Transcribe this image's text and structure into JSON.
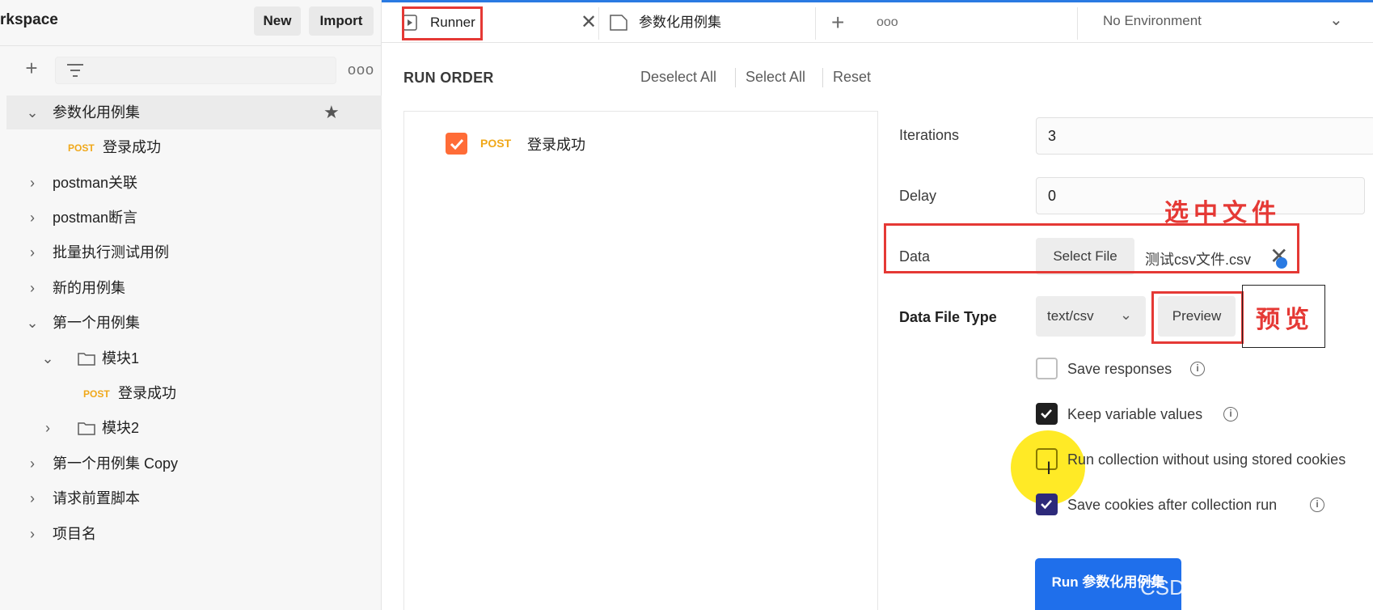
{
  "sidebar": {
    "workspace_title": "rkspace",
    "new_label": "New",
    "import_label": "Import",
    "more_label": "ooo",
    "tree": [
      {
        "label": "参数化用例集",
        "expanded": true,
        "starred": true
      },
      {
        "method": "POST",
        "label": "登录成功"
      },
      {
        "label": "postman关联"
      },
      {
        "label": "postman断言"
      },
      {
        "label": "批量执行测试用例"
      },
      {
        "label": "新的用例集"
      },
      {
        "label": "第一个用例集",
        "expanded": true
      },
      {
        "label": "模块1",
        "folder": true,
        "expanded": true
      },
      {
        "method": "POST",
        "label": "登录成功"
      },
      {
        "label": "模块2",
        "folder": true
      },
      {
        "label": "第一个用例集 Copy"
      },
      {
        "label": "请求前置脚本"
      },
      {
        "label": "项目名"
      }
    ]
  },
  "tabs": {
    "runner_label": "Runner",
    "collection_tab_label": "参数化用例集",
    "more_label": "ooo",
    "environment": "No Environment"
  },
  "run_order": {
    "title": "RUN ORDER",
    "deselect_all": "Deselect All",
    "select_all": "Select All",
    "reset": "Reset",
    "items": [
      {
        "method": "POST",
        "name": "登录成功",
        "checked": true
      }
    ]
  },
  "settings": {
    "iterations_label": "Iterations",
    "iterations_value": "3",
    "delay_label": "Delay",
    "delay_value": "0",
    "data_label": "Data",
    "select_file_label": "Select File",
    "file_name": "测试csv文件.csv",
    "data_file_type_label": "Data File Type",
    "data_file_type_value": "text/csv",
    "preview_label": "Preview",
    "options": [
      {
        "label": "Save responses",
        "checked": false,
        "info": true
      },
      {
        "label": "Keep variable values",
        "checked": true,
        "info": true
      },
      {
        "label": "Run collection without using stored cookies",
        "checked": false,
        "info": false
      },
      {
        "label": "Save cookies after collection run",
        "checked": true,
        "info": true
      }
    ],
    "run_button_label": "Run 参数化用例集"
  },
  "annotations": {
    "select_file_note": "选中文件",
    "preview_note": "预览"
  },
  "watermark": "CSDN @胜天半月子",
  "colors": {
    "accent_orange": "#ff6c37",
    "post_method": "#f0a81a",
    "primary_blue": "#1f6feb",
    "annotation_red": "#e53935"
  }
}
